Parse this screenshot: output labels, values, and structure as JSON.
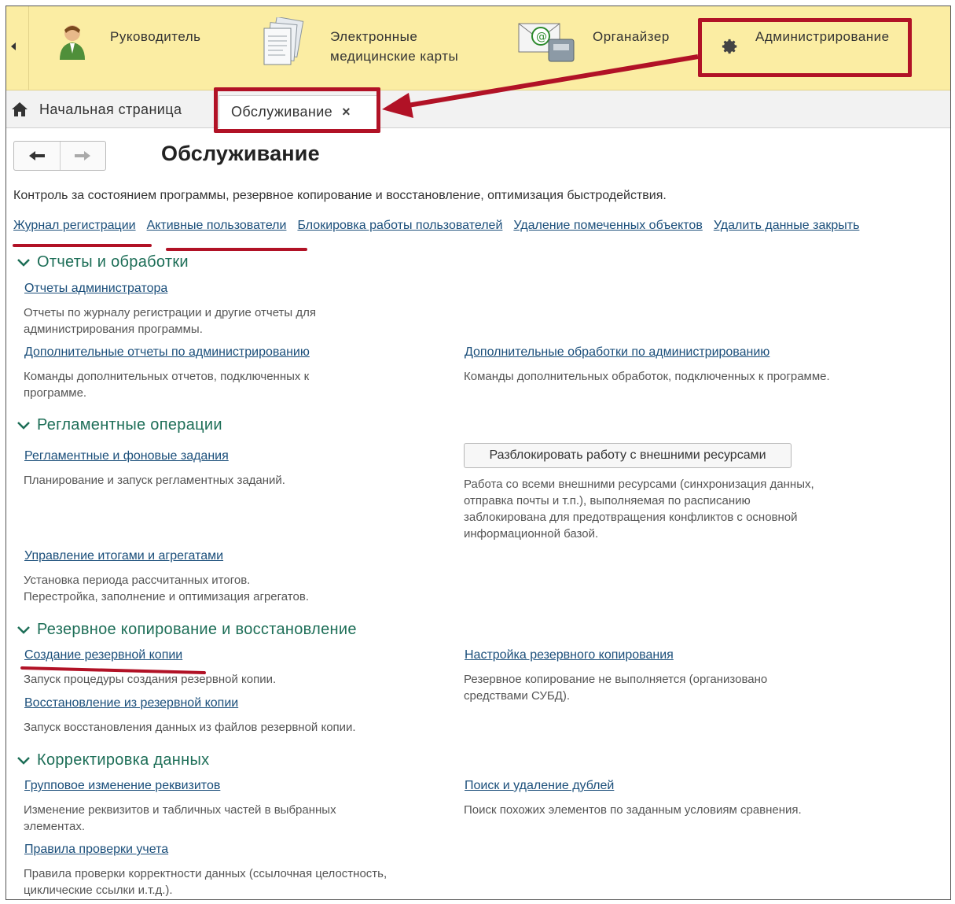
{
  "top_sections": [
    {
      "label": "Руководитель",
      "icon": "manager-person-icon"
    },
    {
      "label_line1": "Электронные",
      "label_line2": "медицинские карты",
      "icon": "documents-stack-icon"
    },
    {
      "label": "Органайзер",
      "icon": "email-phone-icon"
    },
    {
      "label": "Администрирование",
      "icon": "gear-icon"
    }
  ],
  "tabs": {
    "home": "Начальная страница",
    "active": "Обслуживание",
    "close": "×"
  },
  "page": {
    "title": "Обслуживание",
    "description": "Контроль за состоянием программы, резервное копирование и восстановление, оптимизация быстродействия.",
    "top_links": [
      "Журнал регистрации",
      "Активные пользователи",
      "Блокировка работы пользователей",
      "Удаление помеченных объектов",
      "Удалить данные закрыть"
    ]
  },
  "groups": {
    "reports": {
      "title": "Отчеты и обработки",
      "admin_reports": "Отчеты администратора",
      "admin_reports_note1": "Отчеты по журналу регистрации и другие отчеты для",
      "admin_reports_note2": "администрирования программы.",
      "extra_reports": "Дополнительные отчеты по администрированию",
      "extra_reports_note1": "Команды дополнительных отчетов, подключенных к",
      "extra_reports_note2": "программе.",
      "extra_processing": "Дополнительные обработки по администрированию",
      "extra_processing_note": "Команды дополнительных обработок, подключенных к программе."
    },
    "scheduled": {
      "title": "Регламентные операции",
      "jobs": "Регламентные и фоновые задания",
      "jobs_note": "Планирование и запуск регламентных заданий.",
      "unlock_button": "Разблокировать работу с внешними ресурсами",
      "unlock_note1": "Работа со всеми внешними ресурсами (синхронизация данных,",
      "unlock_note2": "отправка почты и т.п.), выполняемая по расписанию",
      "unlock_note3": "заблокирована для предотвращения конфликтов с основной",
      "unlock_note4": "информационной базой.",
      "totals": "Управление итогами и агрегатами",
      "totals_note1": "Установка периода рассчитанных итогов.",
      "totals_note2": "Перестройка, заполнение и оптимизация агрегатов."
    },
    "backup": {
      "title": "Резервное копирование и восстановление",
      "create": "Создание резервной копии",
      "create_note": "Запуск процедуры создания резервной копии.",
      "settings": "Настройка резервного копирования",
      "settings_note1": "Резервное копирование не выполняется (организовано",
      "settings_note2": "средствами СУБД).",
      "restore": "Восстановление из резервной копии",
      "restore_note": "Запуск восстановления данных из файлов резервной копии."
    },
    "correction": {
      "title": "Корректировка данных",
      "group_change": "Групповое изменение реквизитов",
      "group_change_note1": "Изменение реквизитов и табличных частей в выбранных",
      "group_change_note2": "элементах.",
      "duplicates": "Поиск и удаление дублей",
      "duplicates_note": "Поиск похожих элементов по заданным условиям сравнения.",
      "account_rules": "Правила проверки учета",
      "account_rules_note1": "Правила проверки корректности данных (ссылочная целостность,",
      "account_rules_note2": "циклические ссылки и.т.д.)."
    }
  },
  "colors": {
    "top_panel": "#fbeda3",
    "link": "#1a4e7a",
    "group_title": "#1d6e57",
    "annotation_red": "#b11226"
  }
}
